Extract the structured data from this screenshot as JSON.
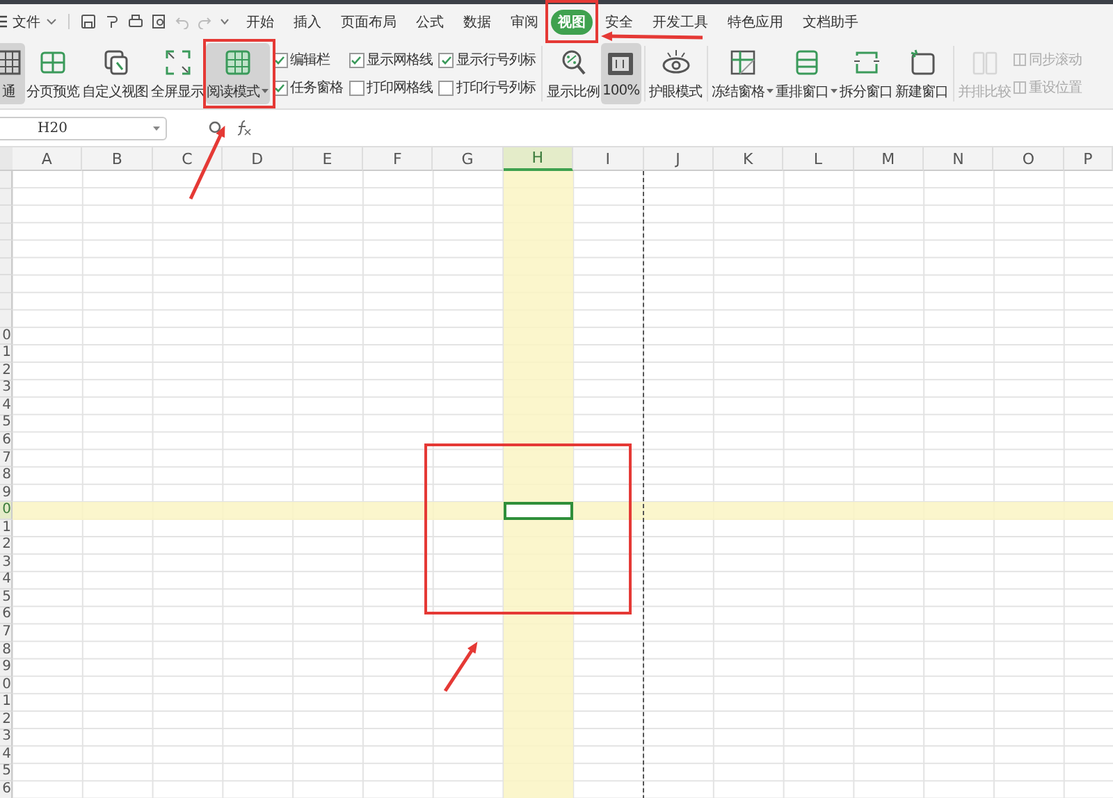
{
  "menu": {
    "file_label": "文件",
    "tabs": [
      {
        "label": "开始",
        "selected": false
      },
      {
        "label": "插入",
        "selected": false
      },
      {
        "label": "页面布局",
        "selected": false
      },
      {
        "label": "公式",
        "selected": false
      },
      {
        "label": "数据",
        "selected": false
      },
      {
        "label": "审阅",
        "selected": false
      },
      {
        "label": "视图",
        "selected": true,
        "annotated": true
      },
      {
        "label": "安全",
        "selected": false
      },
      {
        "label": "开发工具",
        "selected": false
      },
      {
        "label": "特色应用",
        "selected": false
      },
      {
        "label": "文档助手",
        "selected": false
      }
    ]
  },
  "ribbon": [
    {
      "kind": "large",
      "label": "通",
      "selected": true,
      "disabled": false
    },
    {
      "kind": "large",
      "label": "分页预览",
      "selected": false,
      "disabled": false
    },
    {
      "kind": "large",
      "label": "自定义视图",
      "selected": false,
      "disabled": false
    },
    {
      "kind": "large",
      "label": "全屏显示",
      "selected": false,
      "disabled": false
    },
    {
      "kind": "large",
      "label": "阅读模式",
      "selected": true,
      "disabled": false,
      "dropdown": true,
      "annotated": true
    },
    {
      "kind": "checks",
      "items": [
        {
          "label": "编辑栏",
          "checked": true
        },
        {
          "label": "任务窗格",
          "checked": true
        }
      ]
    },
    {
      "kind": "checks",
      "items": [
        {
          "label": "显示网格线",
          "checked": true
        },
        {
          "label": "打印网格线",
          "checked": false
        }
      ]
    },
    {
      "kind": "checks",
      "items": [
        {
          "label": "显示行号列标",
          "checked": true
        },
        {
          "label": "打印行号列标",
          "checked": false
        }
      ]
    },
    {
      "kind": "separator"
    },
    {
      "kind": "large",
      "label": "显示比例",
      "selected": false,
      "disabled": false
    },
    {
      "kind": "large",
      "label": "100%",
      "selected": true,
      "disabled": false
    },
    {
      "kind": "separator"
    },
    {
      "kind": "large",
      "label": "护眼模式",
      "selected": false,
      "disabled": false
    },
    {
      "kind": "separator"
    },
    {
      "kind": "large",
      "label": "冻结窗格",
      "selected": false,
      "disabled": false,
      "dropdown": true
    },
    {
      "kind": "large",
      "label": "重排窗口",
      "selected": false,
      "disabled": false,
      "dropdown": true
    },
    {
      "kind": "large",
      "label": "拆分窗口",
      "selected": false,
      "disabled": false
    },
    {
      "kind": "large",
      "label": "新建窗口",
      "selected": false,
      "disabled": false
    },
    {
      "kind": "separator"
    },
    {
      "kind": "large",
      "label": "并排比较",
      "selected": false,
      "disabled": true
    },
    {
      "kind": "small",
      "items": [
        {
          "label": "同步滚动",
          "disabled": true
        },
        {
          "label": "重设位置",
          "disabled": true
        }
      ]
    }
  ],
  "formula_bar": {
    "name_box": "H20"
  },
  "columns": [
    {
      "label": "A",
      "selected": false,
      "page_break": false
    },
    {
      "label": "B",
      "selected": false,
      "page_break": false
    },
    {
      "label": "C",
      "selected": false,
      "page_break": false
    },
    {
      "label": "D",
      "selected": false,
      "page_break": false
    },
    {
      "label": "E",
      "selected": false,
      "page_break": false
    },
    {
      "label": "F",
      "selected": false,
      "page_break": false
    },
    {
      "label": "G",
      "selected": false,
      "page_break": false
    },
    {
      "label": "H",
      "selected": true,
      "page_break": false
    },
    {
      "label": "I",
      "selected": false,
      "page_break": true
    },
    {
      "label": "J",
      "selected": false,
      "page_break": false
    },
    {
      "label": "K",
      "selected": false,
      "page_break": false
    },
    {
      "label": "L",
      "selected": false,
      "page_break": false
    },
    {
      "label": "M",
      "selected": false,
      "page_break": false
    },
    {
      "label": "N",
      "selected": false,
      "page_break": false
    },
    {
      "label": "O",
      "selected": false,
      "page_break": false
    },
    {
      "label": "P",
      "selected": false,
      "page_break": false
    }
  ],
  "rows": [
    {
      "selected": false
    },
    {
      "selected": false
    },
    {
      "selected": false
    },
    {
      "selected": false
    },
    {
      "selected": false
    },
    {
      "selected": false
    },
    {
      "selected": false
    },
    {
      "selected": false
    },
    {
      "selected": false
    },
    {
      "label": "0",
      "selected": false
    },
    {
      "label": "1",
      "selected": false
    },
    {
      "label": "2",
      "selected": false
    },
    {
      "label": "3",
      "selected": false
    },
    {
      "label": "4",
      "selected": false
    },
    {
      "label": "5",
      "selected": false
    },
    {
      "label": "6",
      "selected": false
    },
    {
      "label": "7",
      "selected": false
    },
    {
      "label": "8",
      "selected": false
    },
    {
      "label": "9",
      "selected": false
    },
    {
      "label": "0",
      "selected": true
    },
    {
      "label": "1",
      "selected": false
    },
    {
      "label": "2",
      "selected": false
    },
    {
      "label": "3",
      "selected": false
    },
    {
      "label": "4",
      "selected": false
    },
    {
      "label": "5",
      "selected": false
    },
    {
      "label": "6",
      "selected": false
    },
    {
      "label": "7",
      "selected": false
    },
    {
      "label": "8",
      "selected": false
    },
    {
      "label": "9",
      "selected": false
    },
    {
      "label": "0",
      "selected": false
    },
    {
      "label": "1",
      "selected": false
    },
    {
      "label": "2",
      "selected": false
    },
    {
      "label": "3",
      "selected": false
    },
    {
      "label": "4",
      "selected": false
    },
    {
      "label": "5",
      "selected": false
    },
    {
      "label": "6",
      "selected": false
    }
  ]
}
